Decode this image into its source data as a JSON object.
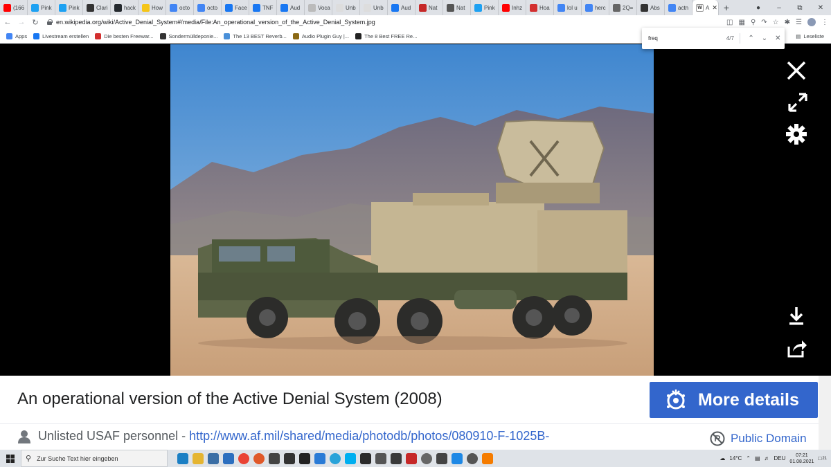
{
  "browser": {
    "tabs": [
      {
        "label": "(166",
        "icon": "youtube-icon",
        "color": "#ff0000"
      },
      {
        "label": "Pink",
        "icon": "twitter-icon",
        "color": "#1da1f2"
      },
      {
        "label": "Pink",
        "icon": "twitter-icon",
        "color": "#1da1f2"
      },
      {
        "label": "Clari",
        "icon": "wikipedia-icon",
        "color": "#333333"
      },
      {
        "label": "hack",
        "icon": "github-icon",
        "color": "#24292e"
      },
      {
        "label": "How",
        "icon": "imdb-icon",
        "color": "#f5c518"
      },
      {
        "label": "octo",
        "icon": "google-icon",
        "color": "#4285f4"
      },
      {
        "label": "octo",
        "icon": "google-icon",
        "color": "#4285f4"
      },
      {
        "label": "Face",
        "icon": "facebook-icon",
        "color": "#1877f2"
      },
      {
        "label": "TNF",
        "icon": "facebook-icon",
        "color": "#1877f2"
      },
      {
        "label": "Aud",
        "icon": "facebook-icon",
        "color": "#1877f2"
      },
      {
        "label": "Voca",
        "icon": "page-icon",
        "color": "#bbbbbb"
      },
      {
        "label": "Unb",
        "icon": "page-icon",
        "color": "#dddddd"
      },
      {
        "label": "Unb",
        "icon": "page-icon",
        "color": "#dddddd"
      },
      {
        "label": "Aud",
        "icon": "facebook-icon",
        "color": "#1877f2"
      },
      {
        "label": "Nat",
        "icon": "b-icon",
        "color": "#c62828"
      },
      {
        "label": "Nat",
        "icon": "news-icon",
        "color": "#555555"
      },
      {
        "label": "Pink",
        "icon": "twitter-icon",
        "color": "#1da1f2"
      },
      {
        "label": "Inhz",
        "icon": "youtube-icon",
        "color": "#ff0000"
      },
      {
        "label": "Hoa",
        "icon": "opera-icon",
        "color": "#d32f2f"
      },
      {
        "label": "lol u",
        "icon": "google-icon",
        "color": "#4285f4"
      },
      {
        "label": "herc",
        "icon": "google-icon",
        "color": "#4285f4"
      },
      {
        "label": "2Q=",
        "icon": "globe-icon",
        "color": "#666666"
      },
      {
        "label": "Abs",
        "icon": "wikipedia-icon",
        "color": "#333333"
      },
      {
        "label": "actn",
        "icon": "google-icon",
        "color": "#4285f4"
      }
    ],
    "active_tab": {
      "label": "A",
      "icon": "wikipedia-icon"
    },
    "new_tab_glyph": "+",
    "url": "en.wikipedia.org/wiki/Active_Denial_System#/media/File:An_operational_version_of_the_Active_Denial_System.jpg",
    "bookmarks": [
      {
        "label": "Apps",
        "color": "#4285f4"
      },
      {
        "label": "Livestream erstellen",
        "color": "#1877f2"
      },
      {
        "label": "Die besten Freewar...",
        "color": "#d32f2f"
      },
      {
        "label": "Sondermülldeponie...",
        "color": "#333333"
      },
      {
        "label": "The 13 BEST Reverb...",
        "color": "#4a90d9"
      },
      {
        "label": "Audio Plugin Guy |...",
        "color": "#8b6914"
      },
      {
        "label": "The 8 Best FREE Re...",
        "color": "#222222"
      }
    ],
    "reading_list": "Leseliste"
  },
  "findbar": {
    "query": "freq",
    "count": "4/7"
  },
  "viewer": {
    "close_icon": "close-icon",
    "expand_icon": "expand-icon",
    "settings_icon": "gear-icon",
    "download_icon": "download-icon",
    "share_icon": "share-icon"
  },
  "caption": {
    "title": "An operational version of the Active Denial System (2008)",
    "more_details": "More details",
    "author": "Unlisted USAF personnel",
    "author_sep": " - ",
    "source_url": "http://www.af.mil/shared/media/photodb/photos/080910-F-1025B-",
    "license": "Public Domain"
  },
  "taskbar": {
    "search_placeholder": "Zur Suche Text hier eingeben",
    "temperature": "14°C",
    "language": "DEU",
    "time": "07:21",
    "date": "01.08.2021",
    "notification_count": "21"
  }
}
